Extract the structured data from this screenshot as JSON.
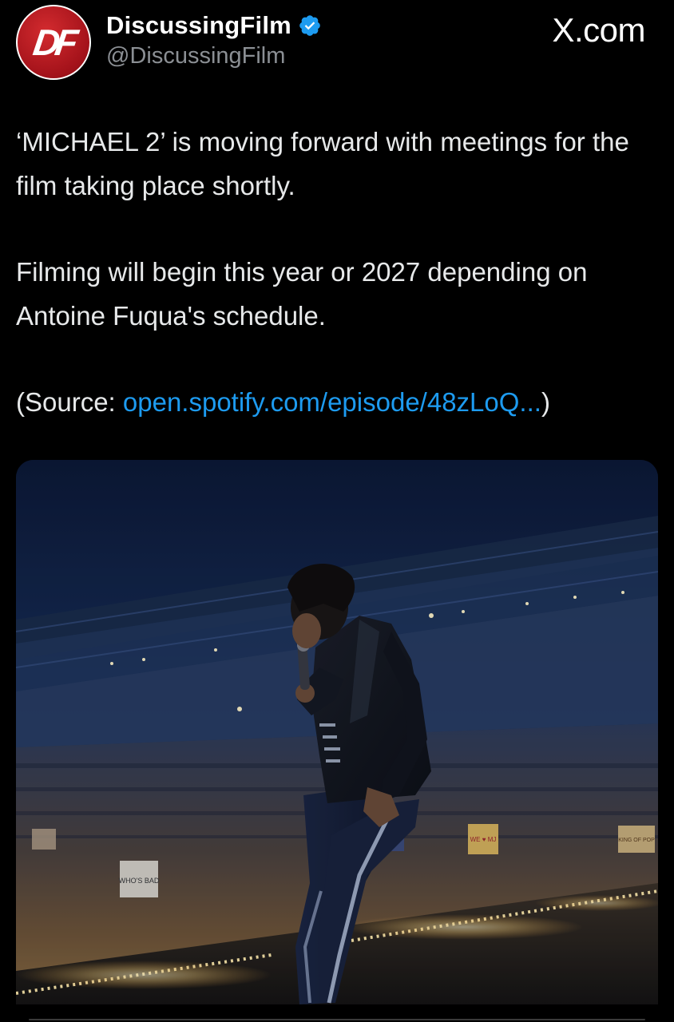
{
  "header": {
    "avatar_letters": "DF",
    "display_name": "DiscussingFilm",
    "handle": "@DiscussingFilm",
    "site_label": "X.com",
    "verified_icon": "verified-badge-icon",
    "verified_color": "#1d9bf0"
  },
  "tweet": {
    "paragraphs": [
      "‘MICHAEL 2’ is moving forward with meetings for the film taking place shortly.",
      "Filming will begin this year or 2027 depending on Antoine Fuqua's schedule."
    ],
    "source_prefix": "(Source: ",
    "source_link": "open.spotify.com/episode/48zLoQ...",
    "source_suffix": ")",
    "link_color": "#1d9bf0"
  },
  "media": {
    "signs": [
      "WHO'S BAD",
      "WE ♥ MJ",
      "KING OF POP"
    ]
  }
}
